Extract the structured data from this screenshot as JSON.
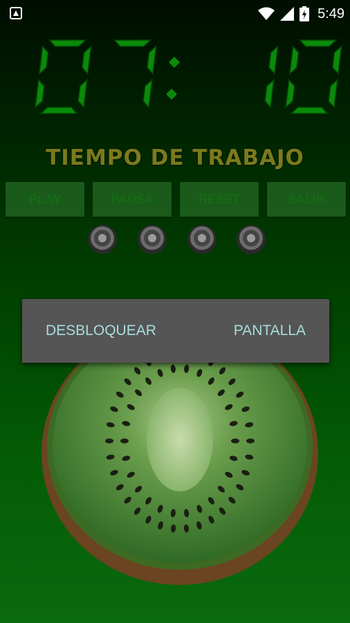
{
  "status_bar": {
    "time": "5:49",
    "icons": [
      "app-notification-icon",
      "wifi-icon",
      "signal-icon",
      "battery-icon"
    ]
  },
  "timer": {
    "display": "07:10",
    "digit_color": "#0a8a0a"
  },
  "mode_label": "TIEMPO DE TRABAJO",
  "controls": {
    "play": "PLAY",
    "pause": "PAUSA",
    "reset": "RESET",
    "exit": "SALIR"
  },
  "pomodoro_indicators": {
    "count": 4,
    "icon": "kiwi-slice-icon"
  },
  "dialog": {
    "unlock_label": "DESBLOQUEAR",
    "screen_label": "PANTALLA"
  },
  "colors": {
    "label": "#7b7a1d",
    "button_bg": "#1a5a1a",
    "button_text": "#156b15",
    "dialog_bg": "#555555",
    "dialog_text": "#a7dede"
  }
}
